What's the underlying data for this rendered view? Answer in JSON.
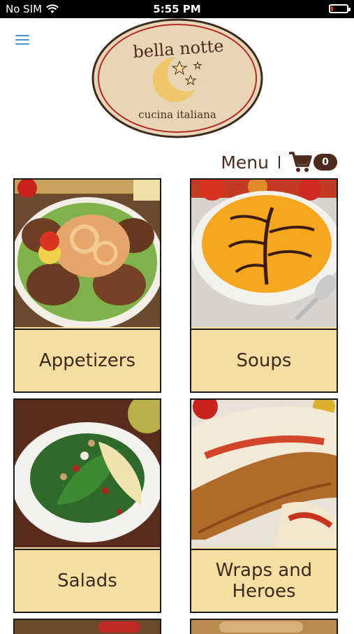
{
  "status_bar": {
    "carrier": "No SIM",
    "time": "5:55 PM"
  },
  "logo": {
    "name": "bella notte",
    "tagline": "cucina italiana"
  },
  "header": {
    "menu_label": "Menu",
    "cart_count": "0"
  },
  "categories": [
    {
      "label": "Appetizers",
      "image": "appetizers-photo"
    },
    {
      "label": "Soups",
      "image": "soup-photo"
    },
    {
      "label": "Salads",
      "image": "salad-photo"
    },
    {
      "label": "Wraps and Heroes",
      "image": "hero-sandwich-photo"
    }
  ],
  "colors": {
    "accent": "#4c2a1e",
    "tile_bg": "#f5dea1",
    "link_blue": "#4a8fd8",
    "logo_bg": "#e8d5b4",
    "logo_ring": "#b3282d"
  }
}
